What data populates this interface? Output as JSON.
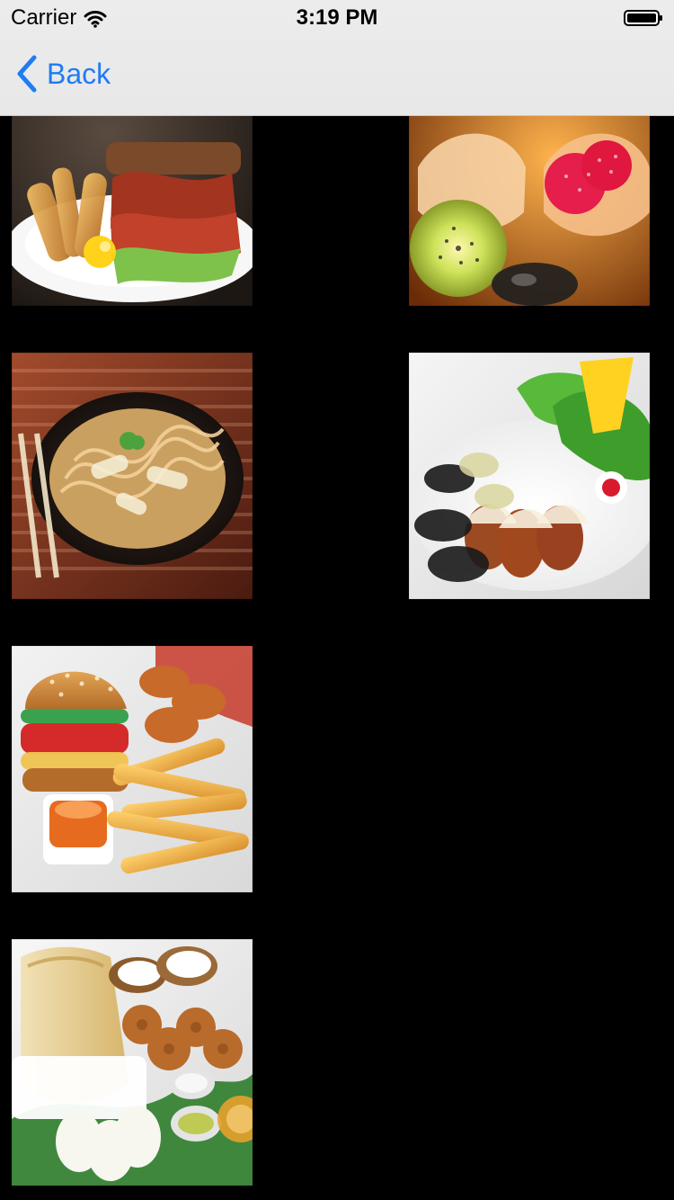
{
  "status_bar": {
    "carrier": "Carrier",
    "time": "3:19 PM",
    "icons": {
      "wifi": "wifi-icon",
      "battery": "battery-icon"
    }
  },
  "nav": {
    "back_label": "Back",
    "back_icon": "chevron-left-icon"
  },
  "colors": {
    "nav_bg": "#e8e8e8",
    "accent": "#1f7cf3",
    "page_bg": "#000000"
  },
  "tiles": [
    {
      "name": "bacon-sandwich-fries-image"
    },
    {
      "name": "fruit-tarts-image"
    },
    {
      "name": "noodles-plate-image"
    },
    {
      "name": "meatballs-salad-plate-image"
    },
    {
      "name": "burger-fries-nuggets-image"
    },
    {
      "name": "dosa-idli-vada-image"
    }
  ]
}
